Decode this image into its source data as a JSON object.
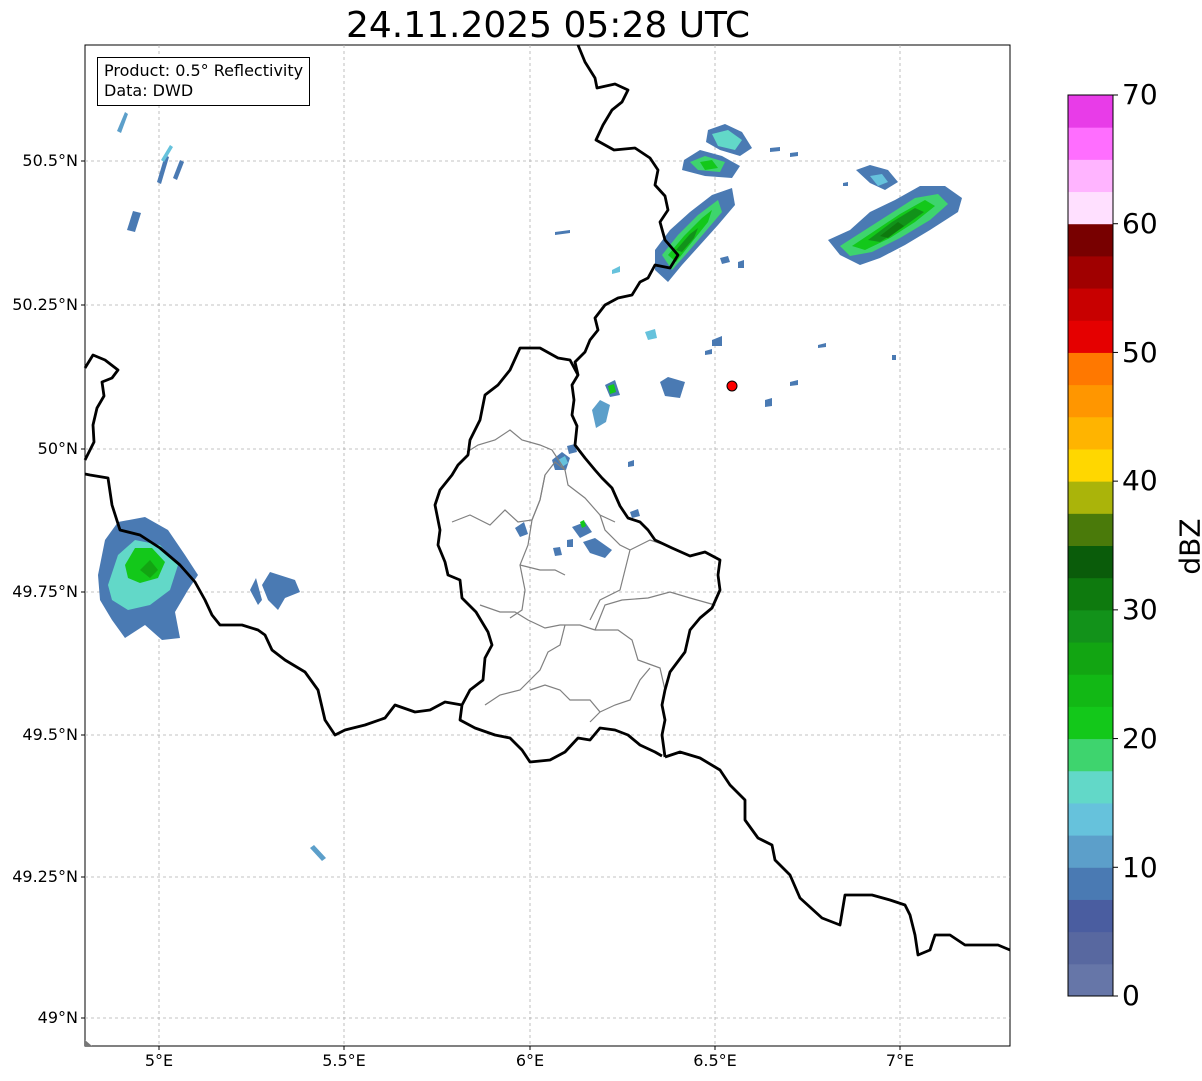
{
  "title": "24.11.2025 05:28 UTC",
  "info_box": {
    "line1": "Product: 0.5° Reflectivity",
    "line2": "Data: DWD"
  },
  "y_ticks": [
    "50.5°N",
    "50.25°N",
    "50°N",
    "49.75°N",
    "49.5°N",
    "49.25°N",
    "49°N"
  ],
  "x_ticks": [
    "5°E",
    "5.5°E",
    "6°E",
    "6.5°E",
    "7°E"
  ],
  "colorbar": {
    "label": "dBZ",
    "ticks": [
      "0",
      "10",
      "20",
      "30",
      "40",
      "50",
      "60",
      "70"
    ],
    "colors": [
      "#6676a8",
      "#5868a0",
      "#4a5da0",
      "#4a7ab3",
      "#5c9fca",
      "#66c2dc",
      "#62d8c8",
      "#3ed46e",
      "#13c81a",
      "#12b815",
      "#12a512",
      "#12921a",
      "#0e7a0e",
      "#0a5c0a",
      "#4a7a0a",
      "#aab40a",
      "#ffd700",
      "#ffb400",
      "#ff9600",
      "#ff7800",
      "#e50000",
      "#c80000",
      "#a00000",
      "#780000",
      "#ffe0ff",
      "#ffb4ff",
      "#ff6eff",
      "#e83ce8"
    ]
  },
  "radar_site_color": "#ff0000"
}
